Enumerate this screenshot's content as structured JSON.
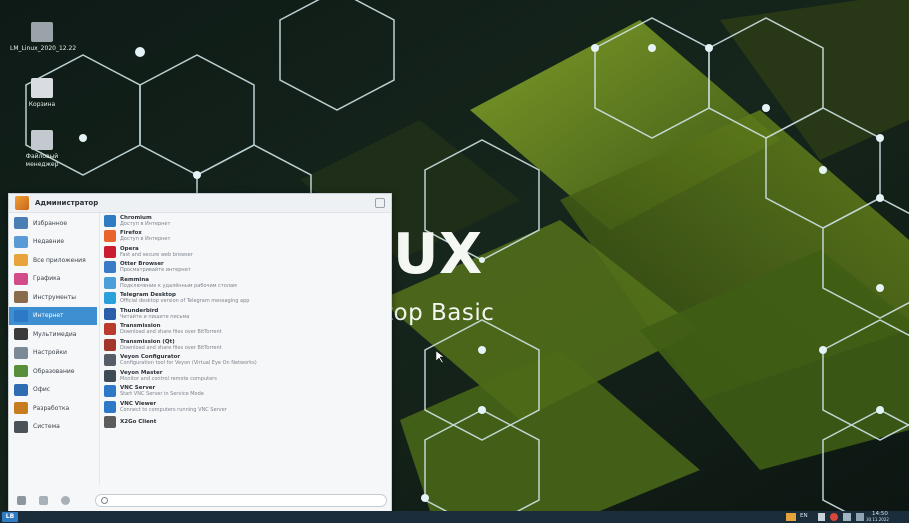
{
  "desktop": {
    "icons": [
      {
        "label": "LM_Linux_2020_12.22",
        "color": "#9aa3aa"
      },
      {
        "label": "Корзина",
        "color": "#d9dde1"
      },
      {
        "label": "Файловый менеджер",
        "color": "#c4c9cf"
      }
    ],
    "wallpaper_text": {
      "line1": "UX",
      "line2": "top Basic"
    }
  },
  "menu": {
    "user": "Администратор",
    "categories": [
      {
        "label": "Избранное",
        "color": "#4a7fb5"
      },
      {
        "label": "Недавние",
        "color": "#5b9bd5"
      },
      {
        "label": "Все приложения",
        "color": "#e8a33d"
      },
      {
        "label": "Графика",
        "color": "#d24c8a"
      },
      {
        "label": "Инструменты",
        "color": "#8a6b4c"
      },
      {
        "label": "Интернет",
        "color": "#2d79c7"
      },
      {
        "label": "Мультимедиа",
        "color": "#3b3b3b"
      },
      {
        "label": "Настройки",
        "color": "#7c8a97"
      },
      {
        "label": "Образование",
        "color": "#5a8f3a"
      },
      {
        "label": "Офис",
        "color": "#2f6db3"
      },
      {
        "label": "Разработка",
        "color": "#c57d1f"
      },
      {
        "label": "Система",
        "color": "#4b5359"
      }
    ],
    "selected_category": "Интернет",
    "apps": [
      {
        "name": "Chromium",
        "desc": "Доступ в Интернет",
        "color": "#2f7cc3"
      },
      {
        "name": "Firefox",
        "desc": "Доступ в Интернет",
        "color": "#e8642a"
      },
      {
        "name": "Opera",
        "desc": "Fast and secure web browser",
        "color": "#cc1b2e"
      },
      {
        "name": "Otter Browser",
        "desc": "Просматривайте интернет",
        "color": "#3a7bc8"
      },
      {
        "name": "Remmina",
        "desc": "Подключение к удалённым рабочим столам",
        "color": "#4a9fd8"
      },
      {
        "name": "Telegram Desktop",
        "desc": "Official desktop version of Telegram messaging app",
        "color": "#2aa1db"
      },
      {
        "name": "Thunderbird",
        "desc": "Читайте и пишите письма",
        "color": "#2a5ea9"
      },
      {
        "name": "Transmission",
        "desc": "Download and share files over BitTorrent",
        "color": "#b83b2e"
      },
      {
        "name": "Transmission (Qt)",
        "desc": "Download and share files over BitTorrent",
        "color": "#a3362b"
      },
      {
        "name": "Veyon Configurator",
        "desc": "Configuration tool for Veyon (Virtual Eye On Networks)",
        "color": "#555e66"
      },
      {
        "name": "Veyon Master",
        "desc": "Monitor and control remote computers",
        "color": "#3e4a55"
      },
      {
        "name": "VNC Server",
        "desc": "Start VNC Server in Service Mode",
        "color": "#2d79c7"
      },
      {
        "name": "VNC Viewer",
        "desc": "Connect to computers running VNC Server",
        "color": "#2d79c7"
      },
      {
        "name": "X2Go Client",
        "desc": "",
        "color": "#5c5c5c"
      }
    ],
    "search_placeholder": ""
  },
  "taskbar": {
    "start_label": "LB",
    "lang": "EN",
    "time": "14:50",
    "date": "30.11.2022"
  },
  "colors": {
    "accent": "#3d8fd1",
    "taskbar": "#1b2d3b",
    "wallpaper_green": "#6f8a1e"
  }
}
